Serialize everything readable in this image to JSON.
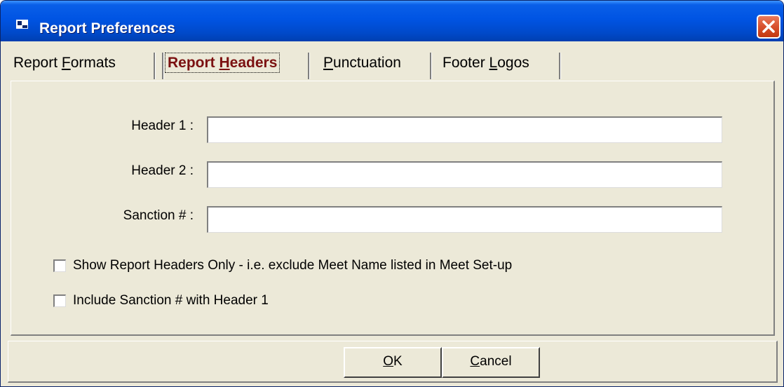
{
  "window": {
    "title": "Report Preferences",
    "icon": "window-app-icon",
    "close_icon": "close-icon",
    "colors": {
      "titlebar": "#0054e3",
      "face": "#ece9d8",
      "close": "#d8512e",
      "active_tab_text": "#7b1111"
    }
  },
  "tabs": [
    {
      "pre": "Report ",
      "u": "F",
      "post": "ormats",
      "active": false
    },
    {
      "pre": "Report ",
      "u": "H",
      "post": "eaders",
      "active": true
    },
    {
      "pre": "",
      "u": "P",
      "post": "unctuation",
      "active": false
    },
    {
      "pre": "Footer ",
      "u": "L",
      "post": "ogos",
      "active": false
    }
  ],
  "fields": [
    {
      "label": "Header 1 :",
      "value": ""
    },
    {
      "label": "Header 2 :",
      "value": ""
    },
    {
      "label": "Sanction # :",
      "value": ""
    }
  ],
  "checkboxes": [
    {
      "label": "Show Report Headers Only - i.e. exclude Meet Name listed in Meet Set-up",
      "checked": false
    },
    {
      "label": "Include Sanction # with Header 1",
      "checked": false
    }
  ],
  "buttons": {
    "ok": {
      "u": "O",
      "post": "K"
    },
    "cancel": {
      "u": "C",
      "post": "ancel"
    }
  }
}
